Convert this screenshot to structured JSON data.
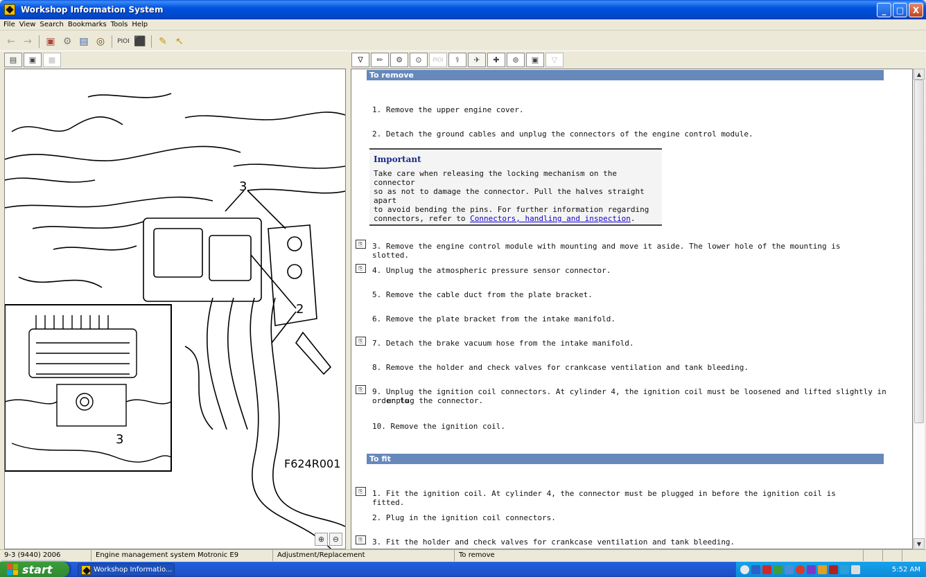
{
  "window": {
    "title": "Workshop Information System",
    "buttons": {
      "minimize": "_",
      "maximize": "□",
      "close": "X"
    }
  },
  "menu": [
    "File",
    "View",
    "Search",
    "Bookmarks",
    "Tools",
    "Help"
  ],
  "toolbar": {
    "back": "←",
    "forward": "→",
    "car": "▣",
    "tool": "⚙",
    "book": "▤",
    "binoculars": "◎",
    "pioi": "PIOI",
    "print": "⬛",
    "pencil": "✎",
    "cursor": "↖"
  },
  "left_tabs": [
    "▤",
    "▣",
    "▦"
  ],
  "right_tabs": [
    "∇",
    "✏",
    "⚙",
    "⊙",
    "PIOI",
    "⚕",
    "✈",
    "✚",
    "⊚",
    "▣",
    "▽"
  ],
  "figure": {
    "code": "F624R001",
    "callouts": [
      "3",
      "2",
      "3"
    ]
  },
  "zoom": {
    "in": "⊕",
    "out": "⊖"
  },
  "sections": {
    "remove": "To remove",
    "fit": "To fit"
  },
  "important": {
    "title": "Important",
    "lines": [
      "Take care when releasing the locking mechanism on the connector",
      "so as not to damage the connector. Pull the halves straight apart",
      "to avoid bending the pins. For further information regarding"
    ],
    "last_prefix": "connectors, refer to ",
    "link": "Connectors, handling and inspection",
    "last_suffix": "."
  },
  "remove_steps": [
    "1. Remove the upper engine cover.",
    "2. Detach the ground cables and unplug the connectors of the engine control module.",
    "3. Remove the engine control module with mounting and move it aside. The lower hole of the mounting is slotted.",
    "4. Unplug the atmospheric pressure sensor connector.",
    "5. Remove the cable duct from the plate bracket.",
    "6. Remove the plate bracket from the intake manifold.",
    "7. Detach the brake vacuum hose from the intake manifold.",
    "8. Remove the holder and check valves for crankcase ventilation and tank bleeding.",
    "9. Unplug the ignition coil connectors. At cylinder 4, the ignition coil must be loosened and lifted slightly in order to",
    "unplug the connector.",
    "10. Remove the ignition coil."
  ],
  "fit_steps": [
    "1. Fit the ignition coil. At cylinder 4, the connector must be plugged in before the ignition coil is fitted.",
    "2. Plug in the ignition coil connectors.",
    "3. Fit the holder and check valves for crankcase ventilation and tank bleeding."
  ],
  "step_icon": "⎘",
  "status": [
    "9-3 (9440) 2006",
    "Engine management system Motronic E9",
    "Adjustment/Replacement",
    "To remove"
  ],
  "taskbar": {
    "start": "start",
    "app": "Workshop Informatio...",
    "clock": "5:52 AM"
  },
  "colors": {
    "section_header": "#6688bb",
    "link": "#1100cc",
    "important_title": "#1a2a8a"
  }
}
